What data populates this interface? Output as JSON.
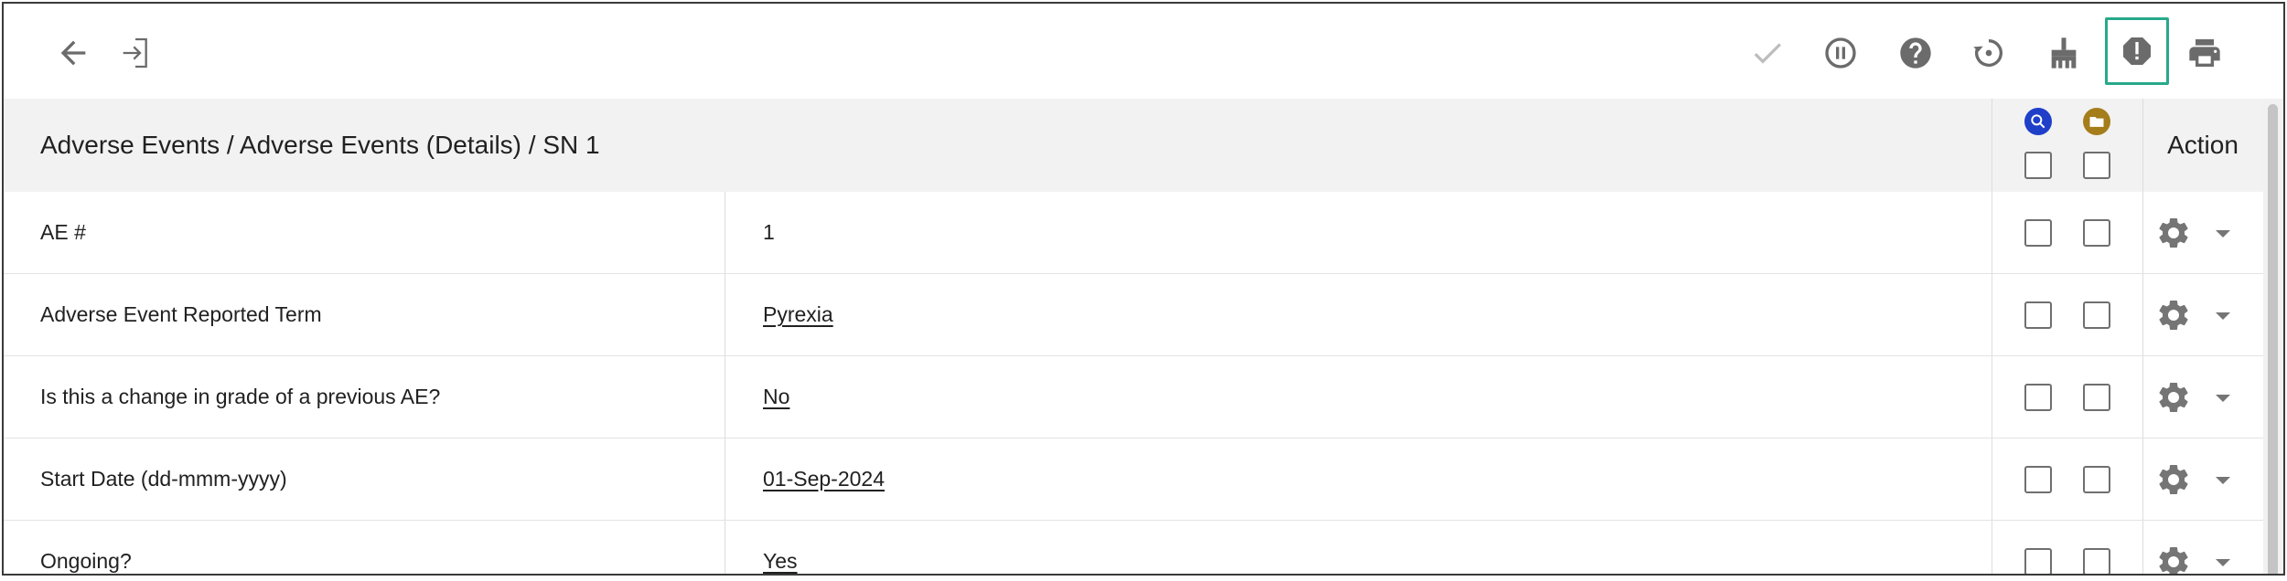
{
  "toolbar": {
    "left_icons": [
      "back-arrow-icon",
      "enter-form-icon"
    ],
    "right_icons": [
      "checkmark-icon",
      "pause-icon",
      "help-icon",
      "history-icon",
      "clear-brush-icon",
      "alert-icon",
      "print-icon"
    ],
    "highlighted": "alert-icon",
    "highlight_color": "#27a98a"
  },
  "header": {
    "breadcrumb": "Adverse Events / Adverse Events (Details) / SN 1",
    "action_label": "Action",
    "column_icons": [
      {
        "name": "query-icon",
        "color": "#1f3fc9"
      },
      {
        "name": "folder-icon",
        "color": "#a57d1b"
      }
    ]
  },
  "rows": [
    {
      "label": "AE #",
      "value": "1",
      "link": false
    },
    {
      "label": "Adverse Event Reported Term",
      "value": "Pyrexia",
      "link": true
    },
    {
      "label": "Is this a change in grade of a previous AE?",
      "value": "No",
      "link": true
    },
    {
      "label": "Start Date (dd-mmm-yyyy)",
      "value": "01-Sep-2024",
      "link": true
    },
    {
      "label": "Ongoing?",
      "value": "Yes",
      "link": true
    }
  ]
}
